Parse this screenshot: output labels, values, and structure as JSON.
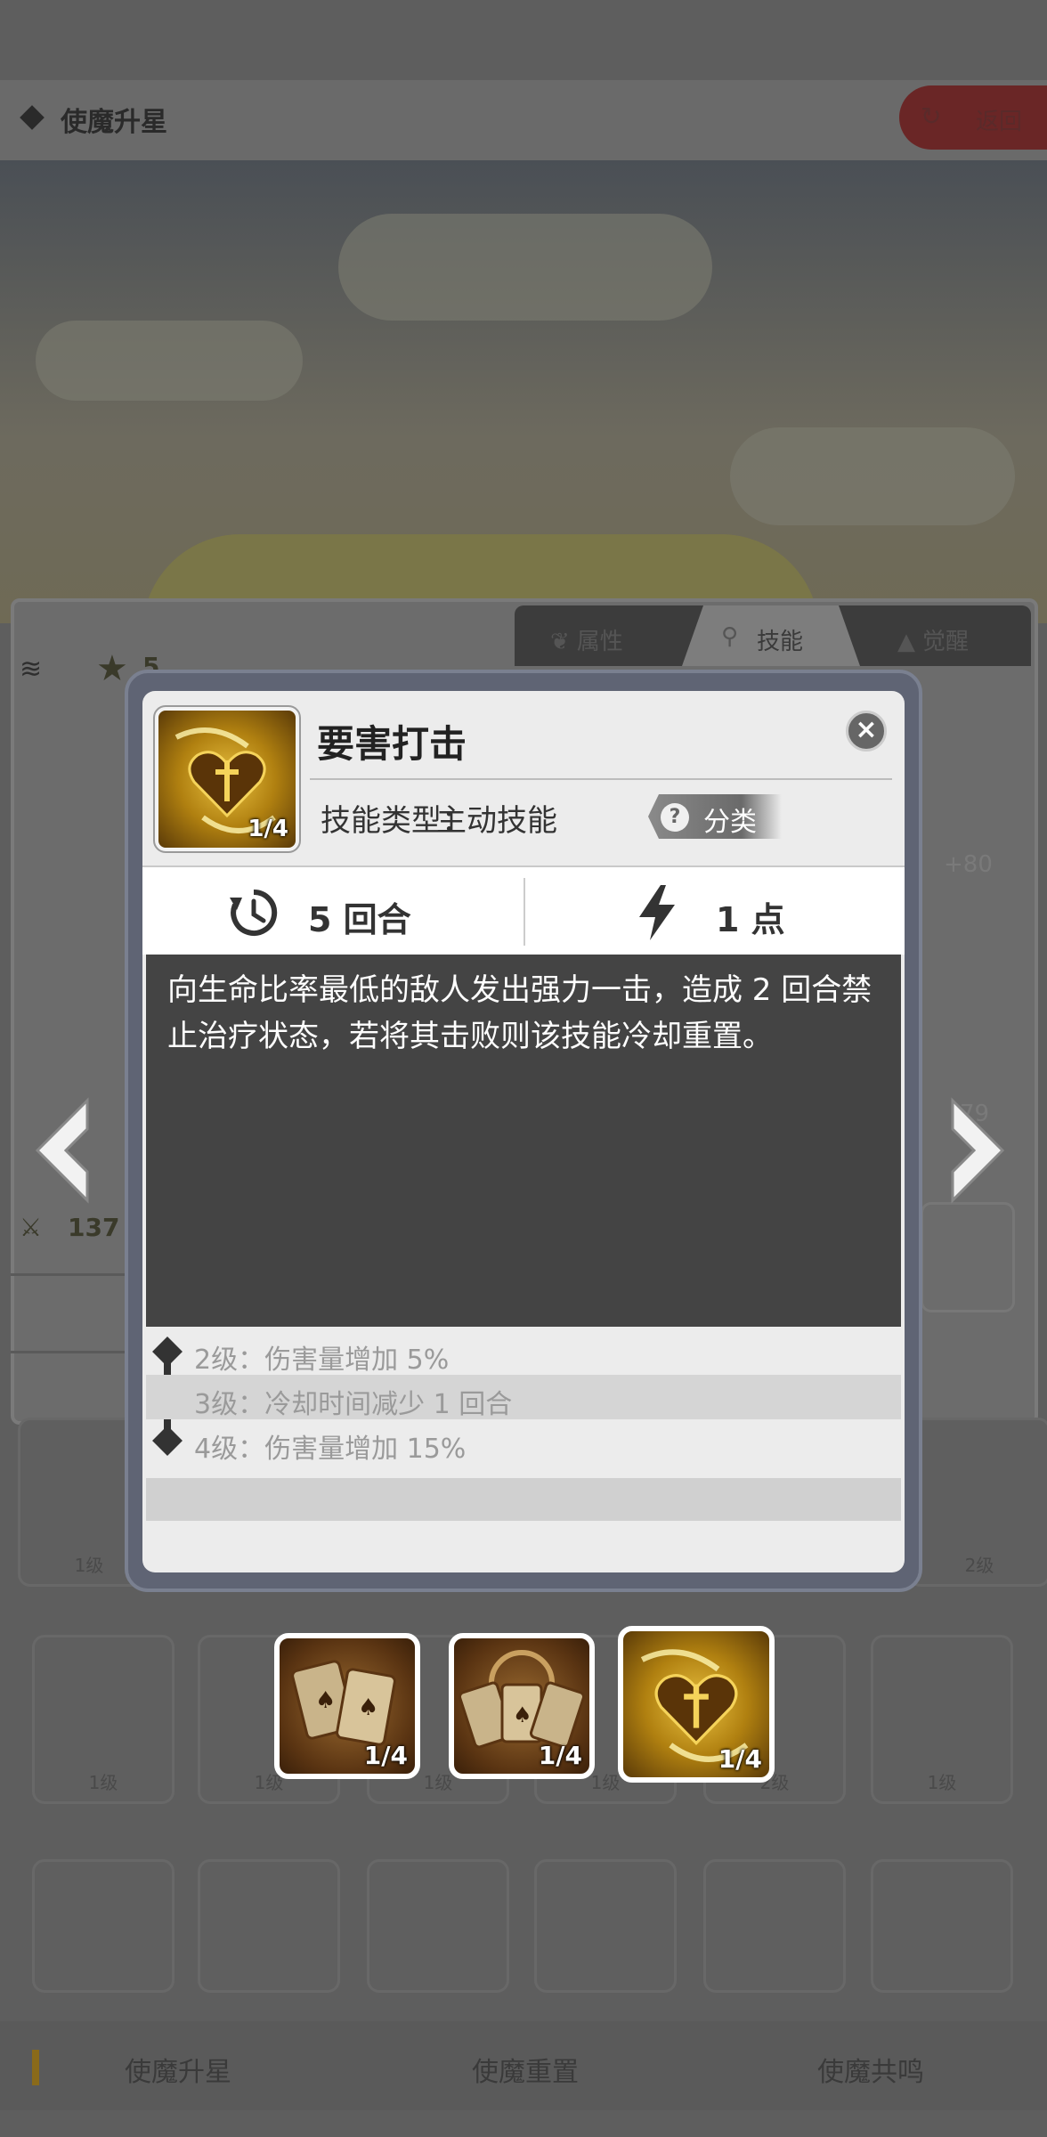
{
  "header": {
    "title": "使魔升星",
    "back_label": "返回"
  },
  "panel": {
    "tabs": [
      {
        "label": "属性"
      },
      {
        "label": "技能"
      },
      {
        "label": "觉醒"
      }
    ],
    "stars": "5",
    "power": "137",
    "stat_plus": "+80",
    "stat_value": "79"
  },
  "modal": {
    "skill_name": "要害打击",
    "icon_count": "1/4",
    "type_label": "技能类型：",
    "type_value": "主动技能",
    "category_label": "分类",
    "cooldown": "5 回合",
    "cost": "1 点",
    "description": "向生命比率最低的敌人发出强力一击，造成 2 回合禁止治疗状态，若将其击败则该技能冷却重置。",
    "levels": [
      {
        "text": "2级：伤害量增加 5%"
      },
      {
        "text": "3级：冷却时间减少 1 回合"
      },
      {
        "text": "4级：伤害量增加 15%"
      }
    ]
  },
  "skill_selector": [
    {
      "count": "1/4",
      "icon": "cards-icon"
    },
    {
      "count": "1/4",
      "icon": "cards-fan-icon"
    },
    {
      "count": "1/4",
      "icon": "heart-dagger-icon"
    }
  ],
  "grid": {
    "row1_levels": [
      "1级",
      "2级"
    ],
    "row2_levels": [
      "1级",
      "1级",
      "1级",
      "1级",
      "2级",
      "1级"
    ]
  },
  "bottom_nav": [
    {
      "label": "使魔升星"
    },
    {
      "label": "使魔重置"
    },
    {
      "label": "使魔共鸣"
    }
  ],
  "colors": {
    "modal_bg": "#ececec",
    "desc_bg": "#444444",
    "icon_gold": "#e8c040"
  }
}
